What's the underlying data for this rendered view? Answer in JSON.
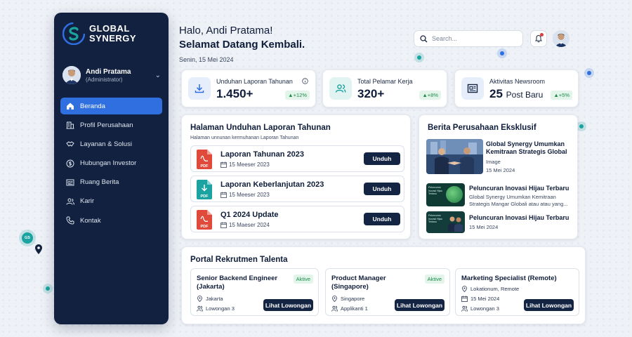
{
  "brand": {
    "line1": "GLOBAL",
    "line2": "SYNERGY"
  },
  "user": {
    "name": "Andi Pratama",
    "role": "(Administrator)"
  },
  "nav": [
    {
      "label": "Beranda",
      "icon": "home-icon"
    },
    {
      "label": "Profil Perusahaan",
      "icon": "building-icon"
    },
    {
      "label": "Layanan & Solusi",
      "icon": "handshake-icon"
    },
    {
      "label": "Hubungan Investor",
      "icon": "dollar-icon"
    },
    {
      "label": "Ruang Berita",
      "icon": "newspaper-icon"
    },
    {
      "label": "Karir",
      "icon": "users-icon"
    },
    {
      "label": "Kontak",
      "icon": "phone-icon"
    }
  ],
  "header": {
    "hello": "Halo, Andi Pratama!",
    "welcome": "Selamat Datang Kembali.",
    "date": "Senin, 15 Mei 2024",
    "search_placeholder": "Search..."
  },
  "stats": [
    {
      "label": "Unduhan Laporan Tahunan",
      "value": "1.450+",
      "unit": "",
      "change": "+12%"
    },
    {
      "label": "Total Pelamar Kerja",
      "value": "320+",
      "unit": "",
      "change": "+8%"
    },
    {
      "label": "Aktivitas Newsroom",
      "value": "25",
      "unit": "Post Baru",
      "change": "+5%"
    }
  ],
  "reports": {
    "title": "Halaman Unduhan Laporan Tahunan",
    "subtitle": "Halaman unnunan kermuhanan Laporan Tahunan",
    "items": [
      {
        "title": "Laporan Tahunan 2023",
        "date": "15 Meeser 2023",
        "button": "Unduh",
        "file_label": "PDF"
      },
      {
        "title": "Laporan Keberlanjutan 2023",
        "date": "15 Meeser 2023",
        "button": "Unduh",
        "file_label": "PDF"
      },
      {
        "title": "Q1 2024 Update",
        "date": "15 Maeser 2024",
        "button": "Unduh",
        "file_label": "PDF"
      }
    ]
  },
  "news": {
    "title": "Berita Perusahaan Eksklusif",
    "items": [
      {
        "title": "Global Synergy Umumkan Kemitraan Strategis Global",
        "meta": "Image",
        "date": "15 Mei 2024"
      },
      {
        "title": "Peluncuran Inovasi Hijau Terbaru",
        "meta": "Global Synergy Umumkan Kemitraan Strategis Mangar Globali atau atau yang...",
        "thumb_text": "Peluncuran Inovasi Hijau Terbaru"
      },
      {
        "title": "Peluncuran Inovasi Hijau Terbaru",
        "date": "15 Mei 2024",
        "thumb_text": "Peluncuran Inovasi Hijau Terbaru"
      }
    ]
  },
  "jobs": {
    "title": "Portal Rekrutmen Talenta",
    "items": [
      {
        "title_line1": "Senior Backend Engineer",
        "title_line2": "(Jakarta)",
        "badge": "Aktive",
        "meta1": "Jakarta",
        "meta2": "Lowongan 3",
        "button": "Lihat Lowongan"
      },
      {
        "title_line1": "Product Manager",
        "title_line2": "(Singapore)",
        "badge": "Aktive",
        "meta1": "Singapore",
        "meta2": "Applikanti 1",
        "button": "Lihat Lowongan"
      },
      {
        "title_line1": "Marketing Specialist (Remote)",
        "title_line2": "",
        "badge": "",
        "meta1": "Lokationum, Remote",
        "meta_date": "15 Mei 2024",
        "meta2": "Lowongan 3",
        "button": "Lihat Lowongan"
      }
    ]
  },
  "map_marker": {
    "label": "GS"
  },
  "colors": {
    "sidebar": "#12213f",
    "accent": "#2f6fe0",
    "teal": "#1aa3a0",
    "pdf_red": "#e04a3a",
    "success": "#1e8a4c"
  }
}
